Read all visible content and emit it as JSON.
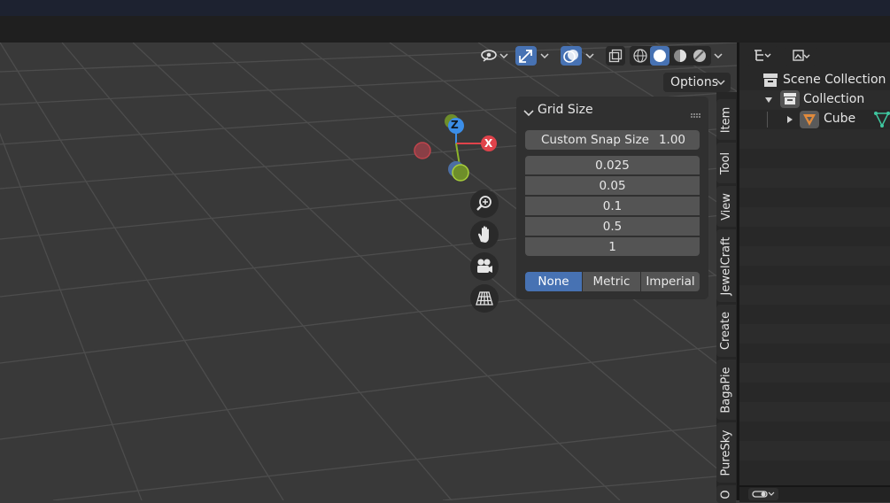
{
  "viewport_header": {
    "options_label": "Options"
  },
  "gizmo": {
    "z_label": "Z",
    "x_label": "X"
  },
  "nav_buttons": [
    "zoom-icon",
    "hand-icon",
    "camera-icon",
    "grid-icon"
  ],
  "grid_size_panel": {
    "title": "Grid Size",
    "custom_snap_label": "Custom Snap Size",
    "custom_snap_value": "1.00",
    "presets": [
      "0.025",
      "0.05",
      "0.1",
      "0.5",
      "1"
    ],
    "unit_systems": [
      {
        "label": "None",
        "active": true
      },
      {
        "label": "Metric",
        "active": false
      },
      {
        "label": "Imperial",
        "active": false
      }
    ]
  },
  "sidebar_tabs": [
    "Item",
    "Tool",
    "View",
    "JewelCraft",
    "Create",
    "BagaPie",
    "PureSky",
    "O"
  ],
  "outliner": {
    "scene_collection": "Scene Collection",
    "collection": "Collection",
    "object": "Cube"
  },
  "colors": {
    "accent_blue": "#4772b3",
    "axis_x": "#e0434b",
    "axis_z": "#3b8ee8",
    "axis_y": "#8db52b",
    "object_orange": "#e08a3c"
  }
}
